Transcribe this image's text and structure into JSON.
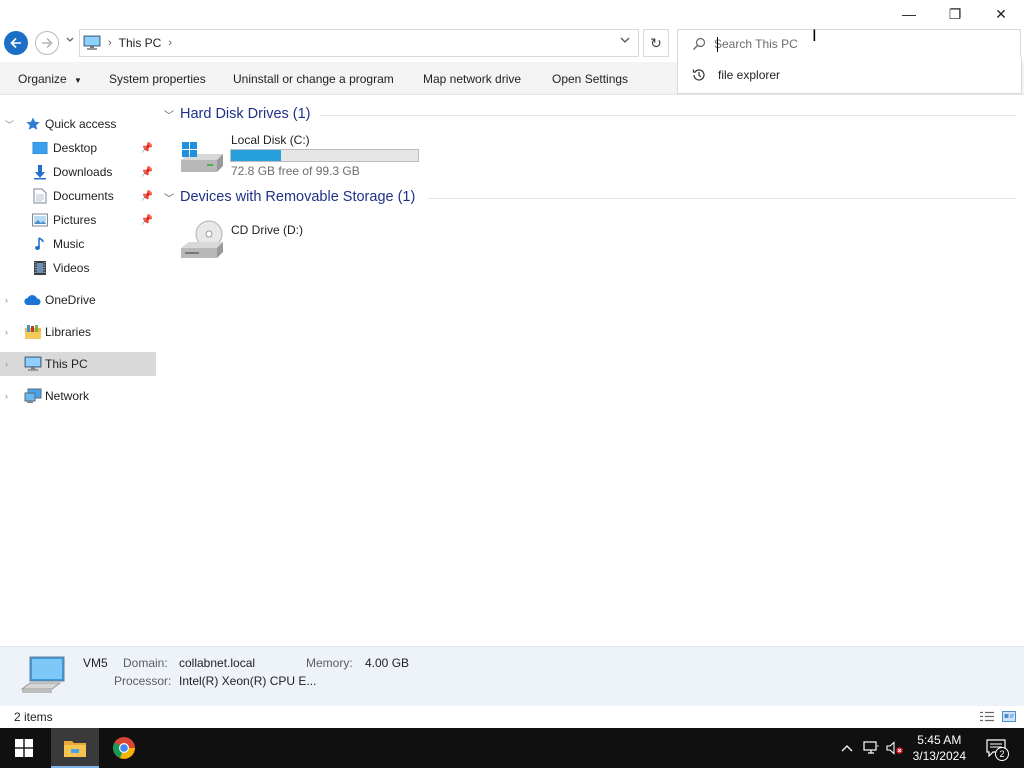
{
  "window": {
    "minimize_glyph": "—",
    "maximize_glyph": "❐",
    "close_glyph": "✕"
  },
  "address": {
    "location": "This PC",
    "refresh_glyph": "↻"
  },
  "search": {
    "placeholder": "Search This PC",
    "value": "",
    "suggestion": "file explorer"
  },
  "toolbar": {
    "organize": "Organize",
    "system_properties": "System properties",
    "uninstall": "Uninstall or change a program",
    "map_drive": "Map network drive",
    "open_settings": "Open Settings"
  },
  "sidebar": {
    "quick_access": "Quick access",
    "items": [
      {
        "label": "Desktop",
        "pinned": true,
        "icon": "desktop-icon"
      },
      {
        "label": "Downloads",
        "pinned": true,
        "icon": "downloads-icon"
      },
      {
        "label": "Documents",
        "pinned": true,
        "icon": "documents-icon"
      },
      {
        "label": "Pictures",
        "pinned": true,
        "icon": "pictures-icon"
      },
      {
        "label": "Music",
        "pinned": false,
        "icon": "music-icon"
      },
      {
        "label": "Videos",
        "pinned": false,
        "icon": "videos-icon"
      }
    ],
    "onedrive": "OneDrive",
    "libraries": "Libraries",
    "this_pc": "This PC",
    "network": "Network"
  },
  "content": {
    "groups": [
      {
        "title": "Hard Disk Drives (1)",
        "drives": [
          {
            "name": "Local Disk (C:)",
            "free_text": "72.8 GB free of 99.3 GB",
            "used_fraction": 0.267
          }
        ]
      },
      {
        "title": "Devices with Removable Storage (1)",
        "drives": [
          {
            "name": "CD Drive (D:)"
          }
        ]
      }
    ]
  },
  "details": {
    "computer_name": "VM5",
    "domain_label": "Domain:",
    "domain_value": "collabnet.local",
    "memory_label": "Memory:",
    "memory_value": "4.00 GB",
    "processor_label": "Processor:",
    "processor_value": "Intel(R) Xeon(R) CPU E..."
  },
  "status": {
    "item_count": "2 items"
  },
  "taskbar": {
    "time": "5:45 AM",
    "date": "3/13/2024",
    "notification_count": "2"
  },
  "colors": {
    "accent": "#1b6fc7",
    "group_title": "#1e3287",
    "usage_fill": "#26a0da",
    "taskbar": "#101010"
  }
}
